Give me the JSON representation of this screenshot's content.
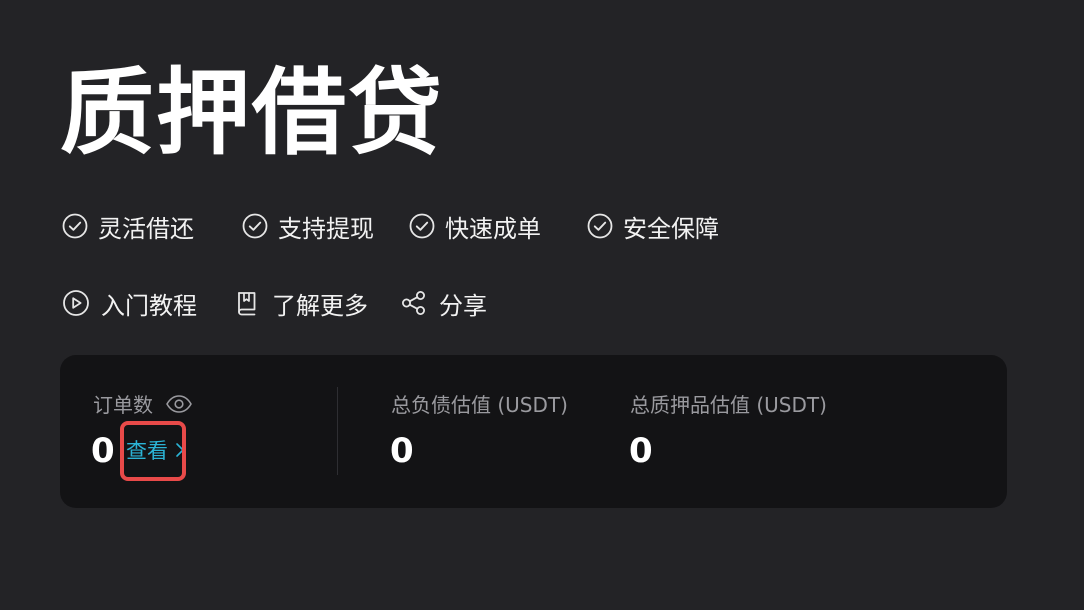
{
  "page": {
    "title": "质押借贷"
  },
  "features": [
    {
      "label": "灵活借还",
      "icon": "check-circle-icon"
    },
    {
      "label": "支持提现",
      "icon": "check-circle-icon"
    },
    {
      "label": "快速成单",
      "icon": "check-circle-icon"
    },
    {
      "label": "安全保障",
      "icon": "check-circle-icon"
    }
  ],
  "links": {
    "tutorial": {
      "label": "入门教程",
      "icon": "play-circle-icon"
    },
    "learn_more": {
      "label": "了解更多",
      "icon": "book-icon"
    },
    "share": {
      "label": "分享",
      "icon": "share-icon"
    }
  },
  "stats": {
    "orders": {
      "label": "订单数",
      "value": "0",
      "view_label": "查看"
    },
    "total_debt": {
      "label": "总负债估值 (USDT)",
      "value": "0"
    },
    "total_collateral": {
      "label": "总质押品估值 (USDT)",
      "value": "0"
    }
  },
  "colors": {
    "background": "#232326",
    "card": "#131315",
    "accent": "#2bb4d6",
    "highlight": "#e84a49",
    "muted_text": "#9a9a9f"
  }
}
